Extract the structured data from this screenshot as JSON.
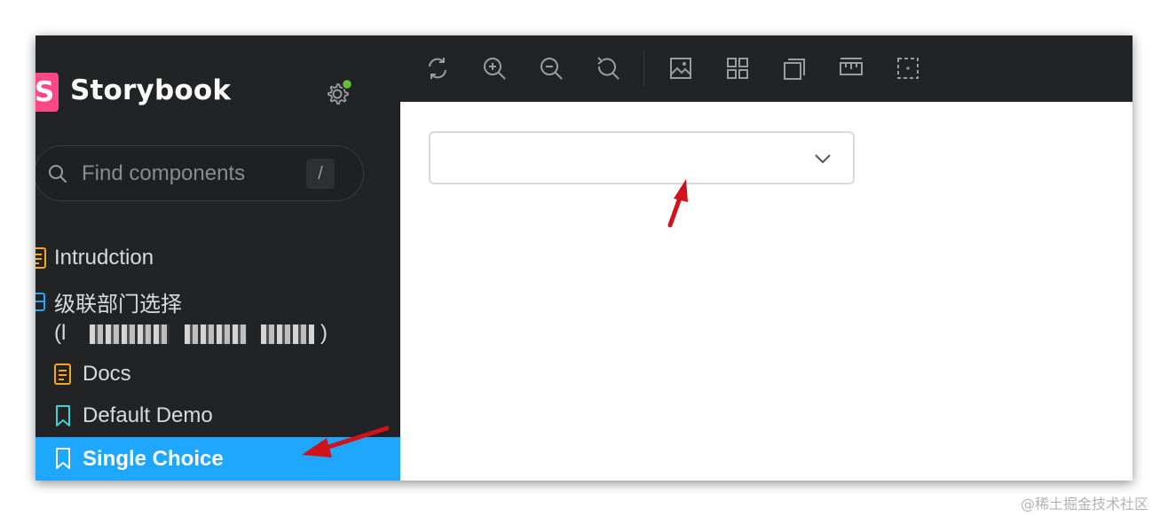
{
  "sidebar": {
    "logo_letter": "S",
    "brand_name": "Storybook",
    "search_placeholder": "Find components",
    "search_shortcut": "/",
    "items": [
      {
        "label": "Intrudction",
        "icon": "document-icon"
      },
      {
        "label": "级联部门选择",
        "icon": "component-icon"
      },
      {
        "label": "(l",
        "icon": "",
        "trailing": ")"
      },
      {
        "label": "Docs",
        "icon": "document-icon"
      },
      {
        "label": "Default Demo",
        "icon": "bookmark-icon"
      },
      {
        "label": "Single Choice",
        "icon": "bookmark-icon",
        "selected": true
      }
    ]
  },
  "toolbar": {
    "buttons": [
      "reload-icon",
      "zoom-in-icon",
      "zoom-out-icon",
      "reset-zoom-icon",
      "background-icon",
      "grid-icon",
      "viewport-icon",
      "measure-icon",
      "outline-icon"
    ]
  },
  "canvas": {
    "select_value": ""
  },
  "watermark": "@稀土掘金技术社区",
  "colors": {
    "sidebar_bg": "#222325",
    "accent": "#1ea7fd",
    "brand": "#ff4785",
    "annotation_arrow": "#d0121b"
  }
}
